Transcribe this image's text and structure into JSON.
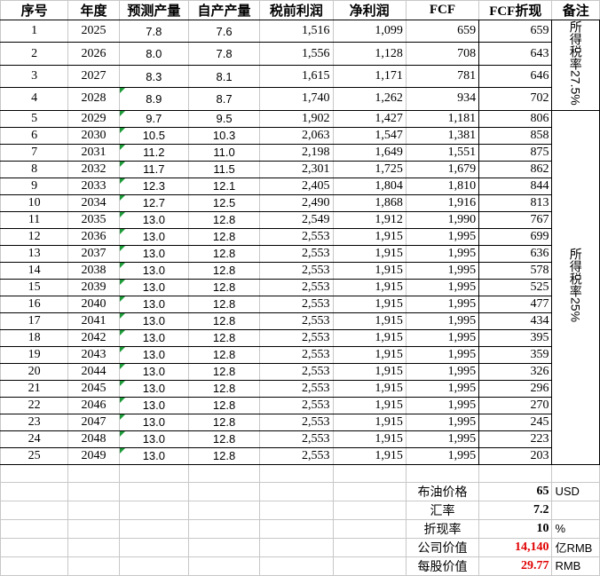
{
  "headers": {
    "seq": "序号",
    "year": "年度",
    "predicted": "预测产量",
    "self": "自产产量",
    "pretax": "税前利润",
    "net": "净利润",
    "fcf": "FCF",
    "fcf_pv": "FCF折现",
    "note": "备注"
  },
  "notes": {
    "first": "所得税率27.5%",
    "second": "所得税率25%"
  },
  "rows": [
    {
      "seq": "1",
      "year": "2025",
      "pred": "7.8",
      "self": "7.6",
      "pretax": "1,516",
      "net": "1,099",
      "fcf": "659",
      "pv": "659"
    },
    {
      "seq": "2",
      "year": "2026",
      "pred": "8.0",
      "self": "7.8",
      "pretax": "1,556",
      "net": "1,128",
      "fcf": "708",
      "pv": "643"
    },
    {
      "seq": "3",
      "year": "2027",
      "pred": "8.3",
      "self": "8.1",
      "pretax": "1,615",
      "net": "1,171",
      "fcf": "781",
      "pv": "646"
    },
    {
      "seq": "4",
      "year": "2028",
      "pred": "8.9",
      "self": "8.7",
      "pretax": "1,740",
      "net": "1,262",
      "fcf": "934",
      "pv": "702"
    },
    {
      "seq": "5",
      "year": "2029",
      "pred": "9.7",
      "self": "9.5",
      "pretax": "1,902",
      "net": "1,427",
      "fcf": "1,181",
      "pv": "806"
    },
    {
      "seq": "6",
      "year": "2030",
      "pred": "10.5",
      "self": "10.3",
      "pretax": "2,063",
      "net": "1,547",
      "fcf": "1,381",
      "pv": "858"
    },
    {
      "seq": "7",
      "year": "2031",
      "pred": "11.2",
      "self": "11.0",
      "pretax": "2,198",
      "net": "1,649",
      "fcf": "1,551",
      "pv": "875"
    },
    {
      "seq": "8",
      "year": "2032",
      "pred": "11.7",
      "self": "11.5",
      "pretax": "2,301",
      "net": "1,725",
      "fcf": "1,679",
      "pv": "862"
    },
    {
      "seq": "9",
      "year": "2033",
      "pred": "12.3",
      "self": "12.1",
      "pretax": "2,405",
      "net": "1,804",
      "fcf": "1,810",
      "pv": "844"
    },
    {
      "seq": "10",
      "year": "2034",
      "pred": "12.7",
      "self": "12.5",
      "pretax": "2,490",
      "net": "1,868",
      "fcf": "1,916",
      "pv": "813"
    },
    {
      "seq": "11",
      "year": "2035",
      "pred": "13.0",
      "self": "12.8",
      "pretax": "2,549",
      "net": "1,912",
      "fcf": "1,990",
      "pv": "767"
    },
    {
      "seq": "12",
      "year": "2036",
      "pred": "13.0",
      "self": "12.8",
      "pretax": "2,553",
      "net": "1,915",
      "fcf": "1,995",
      "pv": "699"
    },
    {
      "seq": "13",
      "year": "2037",
      "pred": "13.0",
      "self": "12.8",
      "pretax": "2,553",
      "net": "1,915",
      "fcf": "1,995",
      "pv": "636"
    },
    {
      "seq": "14",
      "year": "2038",
      "pred": "13.0",
      "self": "12.8",
      "pretax": "2,553",
      "net": "1,915",
      "fcf": "1,995",
      "pv": "578"
    },
    {
      "seq": "15",
      "year": "2039",
      "pred": "13.0",
      "self": "12.8",
      "pretax": "2,553",
      "net": "1,915",
      "fcf": "1,995",
      "pv": "525"
    },
    {
      "seq": "16",
      "year": "2040",
      "pred": "13.0",
      "self": "12.8",
      "pretax": "2,553",
      "net": "1,915",
      "fcf": "1,995",
      "pv": "477"
    },
    {
      "seq": "17",
      "year": "2041",
      "pred": "13.0",
      "self": "12.8",
      "pretax": "2,553",
      "net": "1,915",
      "fcf": "1,995",
      "pv": "434"
    },
    {
      "seq": "18",
      "year": "2042",
      "pred": "13.0",
      "self": "12.8",
      "pretax": "2,553",
      "net": "1,915",
      "fcf": "1,995",
      "pv": "395"
    },
    {
      "seq": "19",
      "year": "2043",
      "pred": "13.0",
      "self": "12.8",
      "pretax": "2,553",
      "net": "1,915",
      "fcf": "1,995",
      "pv": "359"
    },
    {
      "seq": "20",
      "year": "2044",
      "pred": "13.0",
      "self": "12.8",
      "pretax": "2,553",
      "net": "1,915",
      "fcf": "1,995",
      "pv": "326"
    },
    {
      "seq": "21",
      "year": "2045",
      "pred": "13.0",
      "self": "12.8",
      "pretax": "2,553",
      "net": "1,915",
      "fcf": "1,995",
      "pv": "296"
    },
    {
      "seq": "22",
      "year": "2046",
      "pred": "13.0",
      "self": "12.8",
      "pretax": "2,553",
      "net": "1,915",
      "fcf": "1,995",
      "pv": "270"
    },
    {
      "seq": "23",
      "year": "2047",
      "pred": "13.0",
      "self": "12.8",
      "pretax": "2,553",
      "net": "1,915",
      "fcf": "1,995",
      "pv": "245"
    },
    {
      "seq": "24",
      "year": "2048",
      "pred": "13.0",
      "self": "12.8",
      "pretax": "2,553",
      "net": "1,915",
      "fcf": "1,995",
      "pv": "223"
    },
    {
      "seq": "25",
      "year": "2049",
      "pred": "13.0",
      "self": "12.8",
      "pretax": "2,553",
      "net": "1,915",
      "fcf": "1,995",
      "pv": "203"
    }
  ],
  "summary": [
    {
      "label": "布油价格",
      "value": "65",
      "unit": "USD",
      "highlight": false
    },
    {
      "label": "汇率",
      "value": "7.2",
      "unit": "",
      "highlight": false
    },
    {
      "label": "折现率",
      "value": "10",
      "unit": "%",
      "highlight": false
    },
    {
      "label": "公司价值",
      "value": "14,140",
      "unit": "亿RMB",
      "highlight": true
    },
    {
      "label": "每股价值",
      "value": "29.77",
      "unit": "RMB",
      "highlight": true
    }
  ],
  "colors": {
    "grid": "#c8c8c8",
    "highlight": "#e00000",
    "comment_flag": "#1e9c3a"
  }
}
